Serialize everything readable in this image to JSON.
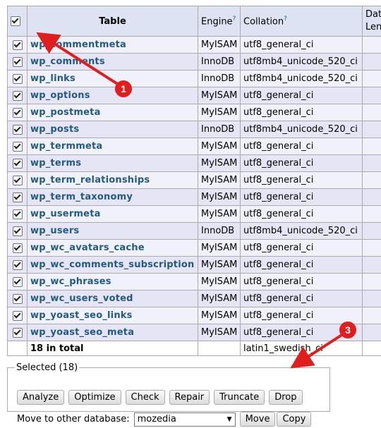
{
  "header": {
    "table_label": "Table",
    "engine_label": "Engine",
    "collation_label": "Collation",
    "help_mark": "?",
    "extra_line1": "Dat",
    "extra_line2": "Len"
  },
  "rows": [
    {
      "name": "wp_commentmeta",
      "engine": "MyISAM",
      "collation": "utf8_general_ci"
    },
    {
      "name": "wp_comments",
      "engine": "InnoDB",
      "collation": "utf8mb4_unicode_520_ci"
    },
    {
      "name": "wp_links",
      "engine": "InnoDB",
      "collation": "utf8mb4_unicode_520_ci"
    },
    {
      "name": "wp_options",
      "engine": "MyISAM",
      "collation": "utf8_general_ci"
    },
    {
      "name": "wp_postmeta",
      "engine": "MyISAM",
      "collation": "utf8_general_ci"
    },
    {
      "name": "wp_posts",
      "engine": "InnoDB",
      "collation": "utf8mb4_unicode_520_ci"
    },
    {
      "name": "wp_termmeta",
      "engine": "MyISAM",
      "collation": "utf8_general_ci"
    },
    {
      "name": "wp_terms",
      "engine": "MyISAM",
      "collation": "utf8_general_ci"
    },
    {
      "name": "wp_term_relationships",
      "engine": "MyISAM",
      "collation": "utf8_general_ci"
    },
    {
      "name": "wp_term_taxonomy",
      "engine": "MyISAM",
      "collation": "utf8_general_ci"
    },
    {
      "name": "wp_usermeta",
      "engine": "MyISAM",
      "collation": "utf8_general_ci"
    },
    {
      "name": "wp_users",
      "engine": "InnoDB",
      "collation": "utf8mb4_unicode_520_ci"
    },
    {
      "name": "wp_wc_avatars_cache",
      "engine": "MyISAM",
      "collation": "utf8_general_ci"
    },
    {
      "name": "wp_wc_comments_subscription",
      "engine": "MyISAM",
      "collation": "utf8_general_ci"
    },
    {
      "name": "wp_wc_phrases",
      "engine": "MyISAM",
      "collation": "utf8_general_ci"
    },
    {
      "name": "wp_wc_users_voted",
      "engine": "MyISAM",
      "collation": "utf8_general_ci"
    },
    {
      "name": "wp_yoast_seo_links",
      "engine": "MyISAM",
      "collation": "utf8_general_ci"
    },
    {
      "name": "wp_yoast_seo_meta",
      "engine": "MyISAM",
      "collation": "utf8_general_ci"
    }
  ],
  "total": {
    "label": "18 in total",
    "collation": "latin1_swedish_ci"
  },
  "selected": {
    "legend": "Selected (18)",
    "buttons": [
      "Analyze",
      "Optimize",
      "Check",
      "Repair",
      "Truncate",
      "Drop"
    ],
    "move_label": "Move to other database:",
    "database_value": "mozedia",
    "move_button": "Move",
    "copy_button": "Copy"
  },
  "annotations": {
    "marker_1": "1",
    "marker_3": "3",
    "color": "#e01e1e"
  }
}
